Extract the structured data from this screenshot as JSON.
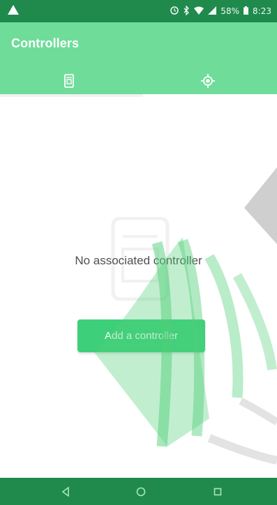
{
  "status_bar": {
    "time": "8:23",
    "battery_percent": "58%",
    "icons": [
      "warning-icon",
      "alarm-icon",
      "bluetooth-icon",
      "wifi-icon",
      "signal-icon",
      "battery-icon"
    ]
  },
  "app_bar": {
    "title": "Controllers",
    "tabs": [
      {
        "icon": "controller-device-icon",
        "selected": true
      },
      {
        "icon": "target-icon",
        "selected": false
      }
    ]
  },
  "main": {
    "empty_message": "No associated controller",
    "add_button_label": "Add a controller"
  },
  "nav_bar": {
    "buttons": [
      "back-icon",
      "home-icon",
      "recents-icon"
    ]
  },
  "colors": {
    "status_bar": "#1f8a4c",
    "app_bar": "#6fdc9a",
    "button": "#3ecf7b",
    "nav_bar": "#1f8a4c"
  }
}
